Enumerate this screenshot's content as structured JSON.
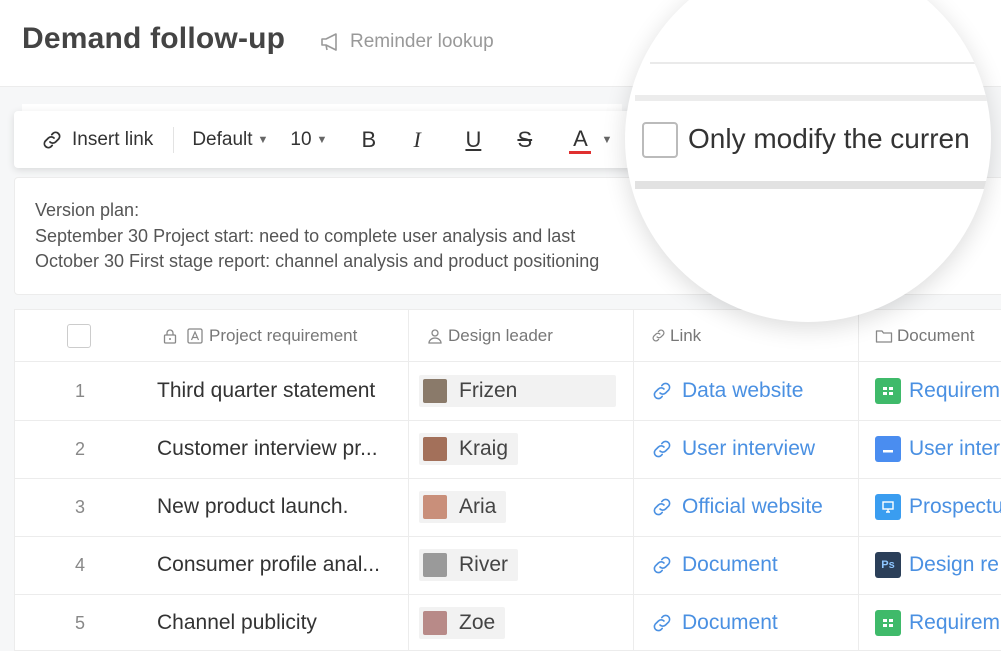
{
  "header": {
    "title": "Demand follow-up",
    "reminder_label": "Reminder lookup"
  },
  "toolbar": {
    "insert_link": "Insert link",
    "font_style": "Default",
    "font_size": "10",
    "bold": "B",
    "italic": "I",
    "underline": "U",
    "strikethrough": "S",
    "text_color": "A",
    "text_color_value": "#e03030"
  },
  "notes": {
    "line1": "Version plan:",
    "line2": "September 30 Project start: need to complete user analysis and last",
    "line3": "October 30 First stage report: channel analysis and product positioning"
  },
  "table": {
    "columns": {
      "requirement": "Project requirement",
      "leader": "Design leader",
      "link": "Link",
      "document": "Document"
    },
    "rows": [
      {
        "num": "1",
        "requirement": "Third quarter statement",
        "leader": "Frizen",
        "link": "Data website",
        "document": "Requirem",
        "doc_type": "sheet"
      },
      {
        "num": "2",
        "requirement": "Customer interview pr...",
        "leader": "Kraig",
        "link": "User interview",
        "document": "User inter",
        "doc_type": "doc"
      },
      {
        "num": "3",
        "requirement": "New product launch.",
        "leader": "Aria",
        "link": "Official website",
        "document": "Prospectu",
        "doc_type": "slide"
      },
      {
        "num": "4",
        "requirement": "Consumer profile anal...",
        "leader": "River",
        "link": "Document",
        "document": "Design re",
        "doc_type": "ps"
      },
      {
        "num": "5",
        "requirement": "Channel publicity",
        "leader": "Zoe",
        "link": "Document",
        "document": "Requirem",
        "doc_type": "sheet"
      }
    ]
  },
  "magnifier": {
    "option_label": "Only modify the curren"
  },
  "colors": {
    "link": "#4a90e2",
    "sheet_icon": "#3fba6a",
    "doc_icon": "#4a8df0",
    "slide_icon": "#3a9df0",
    "ps_icon": "#2b3f59"
  }
}
